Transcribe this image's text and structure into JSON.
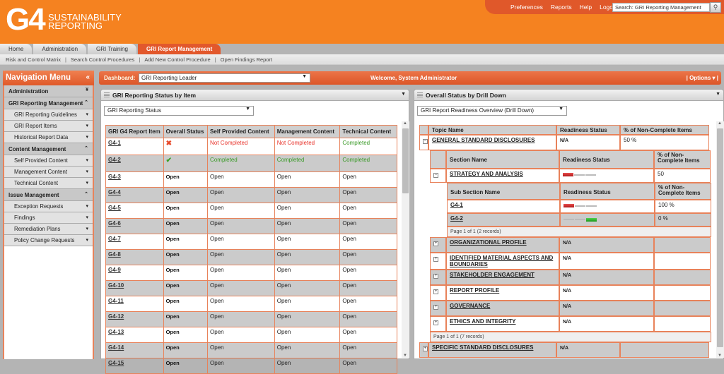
{
  "header": {
    "logo_main": "G4",
    "logo_line1": "SUSTAINABILITY",
    "logo_line2": "REPORTING",
    "top_links": [
      "Preferences",
      "Reports",
      "Help",
      "Logout"
    ],
    "search_value": "Search: GRI Reporting Management"
  },
  "tabs": [
    {
      "label": "Home",
      "active": false
    },
    {
      "label": "Administration",
      "active": false
    },
    {
      "label": "GRI Training",
      "active": false
    },
    {
      "label": "GRI Report Management",
      "active": true
    }
  ],
  "subnav": [
    "Risk and Control Matrix",
    "Search Control Procedures",
    "Add New Control Procedure",
    "Open Findings Report"
  ],
  "sidebar": {
    "title": "Navigation Menu",
    "collapse_glyph": "«",
    "groups": [
      {
        "label": "Administration",
        "glyph": "»",
        "items": []
      },
      {
        "label": "GRI Reporting Management",
        "glyph": "«",
        "items": [
          "GRI Reporting Guidelines",
          "GRI Report Items",
          "Historical Report Data"
        ]
      },
      {
        "label": "Content Management",
        "glyph": "«",
        "items": [
          "Self Provided Content",
          "Management Content",
          "Technical Content"
        ]
      },
      {
        "label": "Issue Management",
        "glyph": "«",
        "items": [
          "Exception Requests",
          "Findings",
          "Remediation Plans",
          "Policy Change Requests"
        ]
      }
    ]
  },
  "dashboard": {
    "label": "Dashboard:",
    "selected": "GRI Reporting Leader",
    "welcome": "Welcome, System Administrator",
    "options": "|  Options ▾  |"
  },
  "left_panel": {
    "title": "GRI Reporting Status by Item",
    "select_value": "GRI Reporting Status",
    "columns": [
      "GRI G4 Report Item",
      "Overall Status",
      "Self Provided Content",
      "Management Content",
      "Technical Content"
    ],
    "rows": [
      {
        "item": "G4-1",
        "overall": "x-icon",
        "self": "Not Completed",
        "mgmt": "Not Completed",
        "tech": "Completed"
      },
      {
        "item": "G4-2",
        "overall": "check-icon",
        "self": "Completed",
        "mgmt": "Completed",
        "tech": "Completed"
      },
      {
        "item": "G4-3",
        "overall": "Open",
        "self": "Open",
        "mgmt": "Open",
        "tech": "Open"
      },
      {
        "item": "G4-4",
        "overall": "Open",
        "self": "Open",
        "mgmt": "Open",
        "tech": "Open"
      },
      {
        "item": "G4-5",
        "overall": "Open",
        "self": "Open",
        "mgmt": "Open",
        "tech": "Open"
      },
      {
        "item": "G4-6",
        "overall": "Open",
        "self": "Open",
        "mgmt": "Open",
        "tech": "Open"
      },
      {
        "item": "G4-7",
        "overall": "Open",
        "self": "Open",
        "mgmt": "Open",
        "tech": "Open"
      },
      {
        "item": "G4-8",
        "overall": "Open",
        "self": "Open",
        "mgmt": "Open",
        "tech": "Open"
      },
      {
        "item": "G4-9",
        "overall": "Open",
        "self": "Open",
        "mgmt": "Open",
        "tech": "Open"
      },
      {
        "item": "G4-10",
        "overall": "Open",
        "self": "Open",
        "mgmt": "Open",
        "tech": "Open"
      },
      {
        "item": "G4-11",
        "overall": "Open",
        "self": "Open",
        "mgmt": "Open",
        "tech": "Open"
      },
      {
        "item": "G4-12",
        "overall": "Open",
        "self": "Open",
        "mgmt": "Open",
        "tech": "Open"
      },
      {
        "item": "G4-13",
        "overall": "Open",
        "self": "Open",
        "mgmt": "Open",
        "tech": "Open"
      },
      {
        "item": "G4-14",
        "overall": "Open",
        "self": "Open",
        "mgmt": "Open",
        "tech": "Open"
      },
      {
        "item": "G4-15",
        "overall": "Open",
        "self": "Open",
        "mgmt": "Open",
        "tech": "Open"
      }
    ]
  },
  "right_panel": {
    "title": "Overall Status by Drill Down",
    "select_value": "GRI Report Readiness Overview (Drill Down)",
    "topic_header": [
      "Topic Name",
      "Readiness Status",
      "% of Non-Complete Items"
    ],
    "topic1": {
      "name": "GENERAL STANDARD DISCLOSURES",
      "status": "N/A",
      "pct": "50 %"
    },
    "section_header": [
      "Section Name",
      "Readiness Status",
      "% of Non-Complete Items"
    ],
    "section1": {
      "name": "STRATEGY AND ANALYSIS",
      "readiness": 0.33,
      "pct": "50"
    },
    "subsection_header": [
      "Sub Section Name",
      "Readiness Status",
      "% of Non-Complete Items"
    ],
    "subsections": [
      {
        "name": "G4-1",
        "readiness": "red-first",
        "pct": "100 %"
      },
      {
        "name": "G4-2",
        "readiness": "green-last",
        "pct": "0 %"
      }
    ],
    "subsection_pager": "Page 1 of 1 (2 records)",
    "sections": [
      {
        "name": "ORGANIZATIONAL PROFILE",
        "status": "N/A"
      },
      {
        "name": "IDENTIFIED MATERIAL ASPECTS AND BOUNDARIES",
        "status": "N/A"
      },
      {
        "name": "STAKEHOLDER ENGAGEMENT",
        "status": "N/A"
      },
      {
        "name": "REPORT PROFILE",
        "status": "N/A"
      },
      {
        "name": "GOVERNANCE",
        "status": "N/A"
      },
      {
        "name": "ETHICS AND INTEGRITY",
        "status": "N/A"
      }
    ],
    "section_pager": "Page 1 of 1 (7 records)",
    "topic2": {
      "name": "SPECIFIC STANDARD DISCLOSURES",
      "status": "N/A"
    }
  },
  "colors": {
    "brand_orange": "#f58220",
    "accent_red": "#e0582a",
    "completed_green": "#3a9a28",
    "not_completed_red": "#e8322a"
  }
}
